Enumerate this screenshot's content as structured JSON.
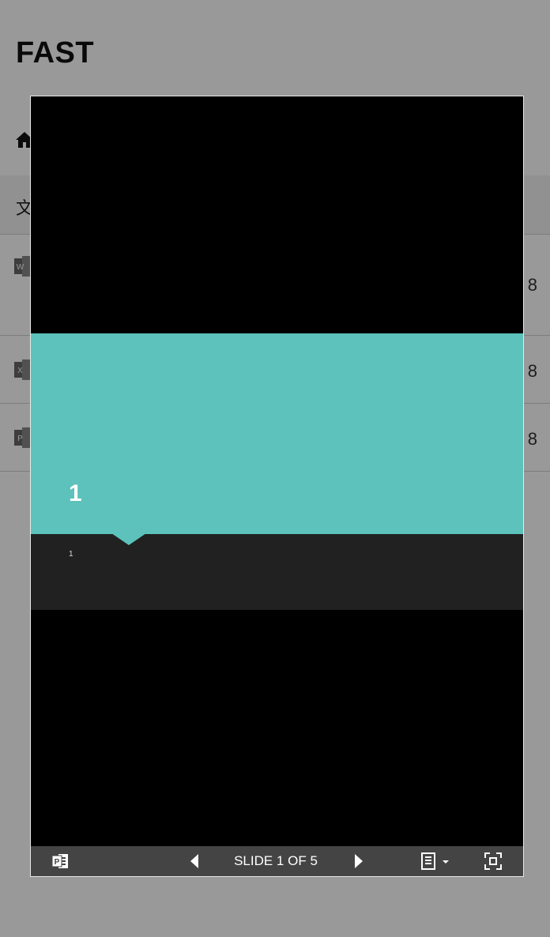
{
  "app": {
    "title": "FAST"
  },
  "list": {
    "header_label": "文",
    "rows": [
      {
        "type": "word",
        "icon_letter": "W",
        "date_suffix": "8"
      },
      {
        "type": "excel",
        "icon_letter": "X",
        "date_suffix": "8"
      },
      {
        "type": "powerpoint",
        "icon_letter": "P",
        "date_suffix": "8"
      }
    ]
  },
  "viewer": {
    "slide": {
      "title": "1",
      "subtitle": "1",
      "colors": {
        "band": "#5cc2bb",
        "footer": "#212121",
        "background": "#000000"
      }
    },
    "toolbar": {
      "slide_counter": "SLIDE 1 OF 5",
      "icons": {
        "app": "powerpoint-icon",
        "prev": "previous-slide-icon",
        "next": "next-slide-icon",
        "notes": "notes-menu-icon",
        "fullscreen": "fullscreen-icon"
      }
    }
  }
}
